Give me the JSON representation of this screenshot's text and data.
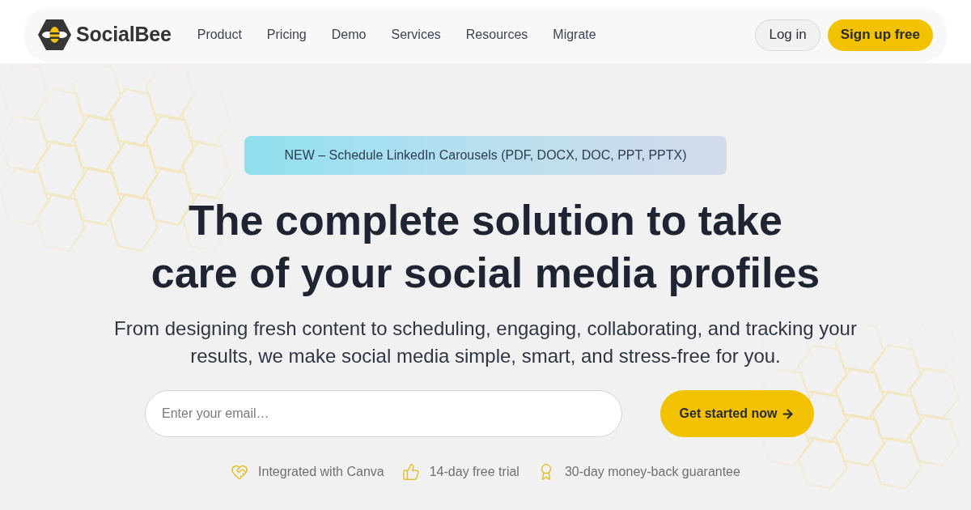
{
  "nav": {
    "logo": "SocialBee",
    "links": [
      "Product",
      "Pricing",
      "Demo",
      "Services",
      "Resources",
      "Migrate"
    ],
    "actions": [
      {
        "label": "Log in",
        "kind": "secondary"
      },
      {
        "label": "Sign up free",
        "kind": "primary"
      }
    ]
  },
  "hero": {
    "banner": "NEW – Schedule LinkedIn Carousels (PDF, DOCX, DOC, PPT, PPTX)",
    "title": "The complete solution to take care of your social media profiles",
    "subtitle": "From designing fresh content to scheduling, engaging, collaborating, and tracking your results, we make social media simple, smart, and stress-free for you.",
    "email_field": {
      "placeholder": "Enter your email…"
    },
    "cta": "Get started now"
  },
  "features": [
    {
      "kind": "canva",
      "label": "Integrated with Canva"
    },
    {
      "kind": "trial",
      "label": "14-day free trial"
    },
    {
      "kind": "guarantee",
      "label": "30-day money-back guarantee"
    }
  ]
}
